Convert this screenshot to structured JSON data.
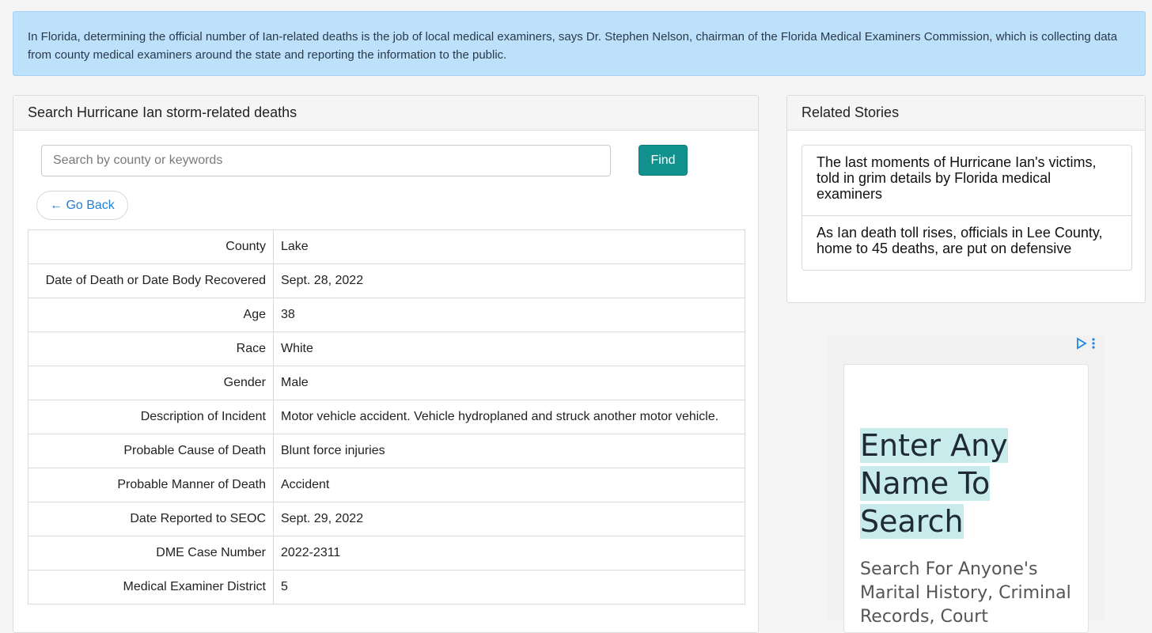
{
  "banner": {
    "text": "In Florida, determining the official number of Ian-related deaths is the job of local medical examiners, says Dr. Stephen Nelson, chairman of the Florida Medical Examiners Commission, which is collecting data from county medical examiners around the state and reporting the information to the public."
  },
  "search_panel": {
    "title": "Search Hurricane Ian storm-related deaths",
    "search_placeholder": "Search by county or keywords",
    "search_value": "",
    "find_label": "Find",
    "go_back_label": "← Go Back",
    "rows": [
      {
        "label": "County",
        "value": "Lake"
      },
      {
        "label": "Date of Death or Date Body Recovered",
        "value": "Sept. 28, 2022"
      },
      {
        "label": "Age",
        "value": "38"
      },
      {
        "label": "Race",
        "value": "White"
      },
      {
        "label": "Gender",
        "value": "Male"
      },
      {
        "label": "Description of Incident",
        "value": "Motor vehicle accident. Vehicle hydroplaned and struck another motor vehicle."
      },
      {
        "label": "Probable Cause of Death",
        "value": "Blunt force injuries"
      },
      {
        "label": "Probable Manner of Death",
        "value": "Accident"
      },
      {
        "label": "Date Reported to SEOC",
        "value": "Sept. 29, 2022"
      },
      {
        "label": "DME Case Number",
        "value": "2022-2311"
      },
      {
        "label": "Medical Examiner District",
        "value": "5"
      }
    ]
  },
  "related": {
    "title": "Related Stories",
    "stories": [
      {
        "title": "The last moments of Hurricane Ian's victims, told in grim details by Florida medical examiners"
      },
      {
        "title": "As Ian death toll rises, officials in Lee County, home to 45 deaths, are put on defensive"
      }
    ]
  },
  "ad": {
    "icons": [
      "ad-choices-icon",
      "more-options-icon"
    ],
    "headline": "Enter Any Name To Search",
    "subtext": "Search For Anyone's Marital History, Criminal Records, Court"
  },
  "colors": {
    "banner_bg": "#bde0fb",
    "find_button": "#12928f",
    "link": "#1f7fd6",
    "ad_highlight": "#c8ecec"
  }
}
